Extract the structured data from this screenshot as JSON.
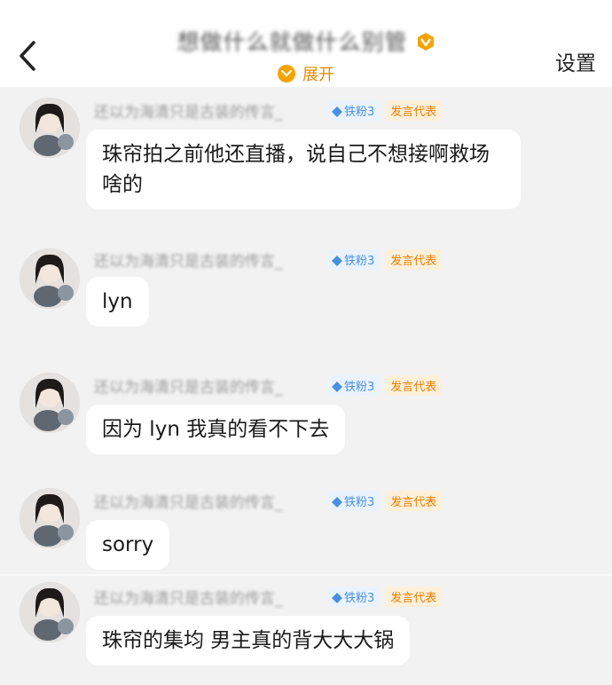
{
  "header": {
    "title_visible": "想做什么就做什么别管",
    "expand_label": "展开",
    "settings_label": "设置"
  },
  "badges": {
    "fan_label": "铁粉3",
    "rep_label": "发言代表"
  },
  "messages": [
    {
      "username": "还以为海清只是古装的传言_",
      "text": "珠帘拍之前他还直播，说自己不想接啊救场啥的"
    },
    {
      "username": "还以为海清只是古装的传言_",
      "text": "lyn"
    },
    {
      "username": "还以为海清只是古装的传言_",
      "text": "因为 lyn 我真的看不下去"
    },
    {
      "username": "还以为海清只是古装的传言_",
      "text": "sorry"
    },
    {
      "username": "还以为海清只是古装的传言_",
      "text": "珠帘的集均 男主真的背大大大锅"
    }
  ],
  "colors": {
    "accent": "#f5a300",
    "fan_blue": "#4a90e2",
    "rep_orange": "#e87e00",
    "background": "#f2f2f2"
  },
  "icons": [
    "back-arrow-icon",
    "verified-v-icon",
    "chevron-down-icon",
    "diamond-icon"
  ]
}
